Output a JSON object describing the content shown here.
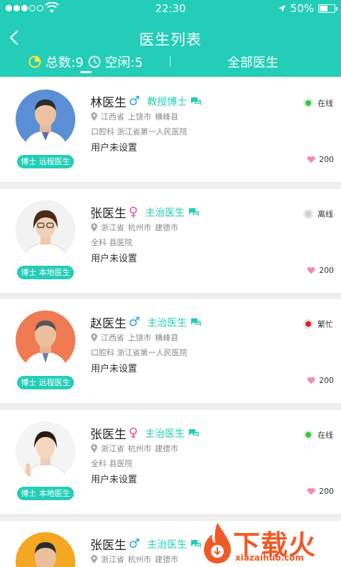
{
  "status_bar": {
    "time": "22:30",
    "battery": "50%"
  },
  "header": {
    "title": "医生列表"
  },
  "tabs": {
    "total": "总数:9",
    "idle": "空闲:5",
    "all": "全部医生"
  },
  "doctors": [
    {
      "name": "林医生",
      "gender": "♂",
      "title": "教授博士",
      "location": [
        "江西省",
        "上饶市",
        "横峰县"
      ],
      "dept": "口腔科 浙江省第一人民医院",
      "desc": "用户未设置",
      "tag": "博士 远程医生",
      "status": "在线",
      "likes": "200"
    },
    {
      "name": "张医生",
      "gender": "♀",
      "title": "主治医生",
      "location": [
        "浙江省",
        "杭州市",
        "建德市"
      ],
      "dept": "全科 县医院",
      "desc": "用户未设置",
      "tag": "博士 本地医生",
      "status": "离线",
      "likes": "200"
    },
    {
      "name": "赵医生",
      "gender": "♂",
      "title": "主治医生",
      "location": [
        "江西省",
        "上饶市",
        "横峰县"
      ],
      "dept": "口腔科 浙江省第一人民医院",
      "desc": "用户未设置",
      "tag": "博士 远程医生",
      "status": "繁忙",
      "likes": "200"
    },
    {
      "name": "张医生",
      "gender": "♀",
      "title": "主治医生",
      "location": [
        "浙江省",
        "杭州市",
        "建德市"
      ],
      "dept": "全科 县医院",
      "desc": "用户未设置",
      "tag": "博士 本地医生",
      "status": "在线",
      "likes": "200"
    },
    {
      "name": "张医生",
      "gender": "♂",
      "title": "主治医生",
      "location": [
        "浙江省",
        "杭州市",
        "建德市"
      ]
    }
  ],
  "watermark": {
    "name": "下载火",
    "url": "xiazaihuo.com"
  },
  "colors": {
    "accent": "#23cdb7",
    "online": "#2ecc40",
    "offline": "#cccccc",
    "busy": "#e02020",
    "male": "#2aa5e6",
    "female": "#e8509b",
    "heart": "#f08cb0"
  }
}
